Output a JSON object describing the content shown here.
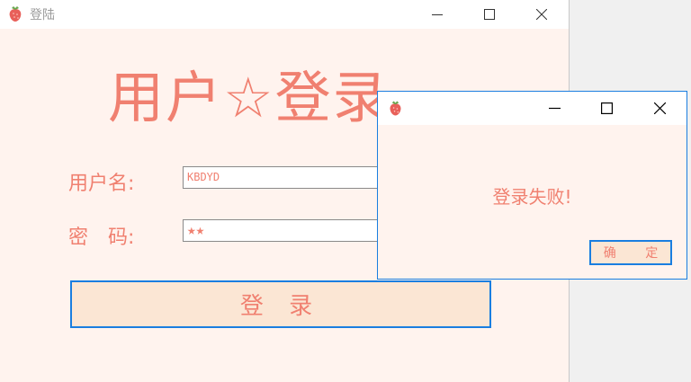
{
  "main_window": {
    "title": "登陆",
    "icon": "strawberry-icon",
    "heading": "用户☆登录",
    "username_label": "用户名:",
    "username_value": "KBDYD",
    "password_label": "密　码:",
    "password_value": "★★",
    "login_button": "登 录"
  },
  "dialog": {
    "icon": "strawberry-icon",
    "message": "登录失败!",
    "ok_button": "确 定"
  },
  "colors": {
    "accent_text": "#f08070",
    "window_bg": "#fff3ee",
    "button_bg": "#fbe6d4",
    "focus_border": "#1a7ee0"
  }
}
